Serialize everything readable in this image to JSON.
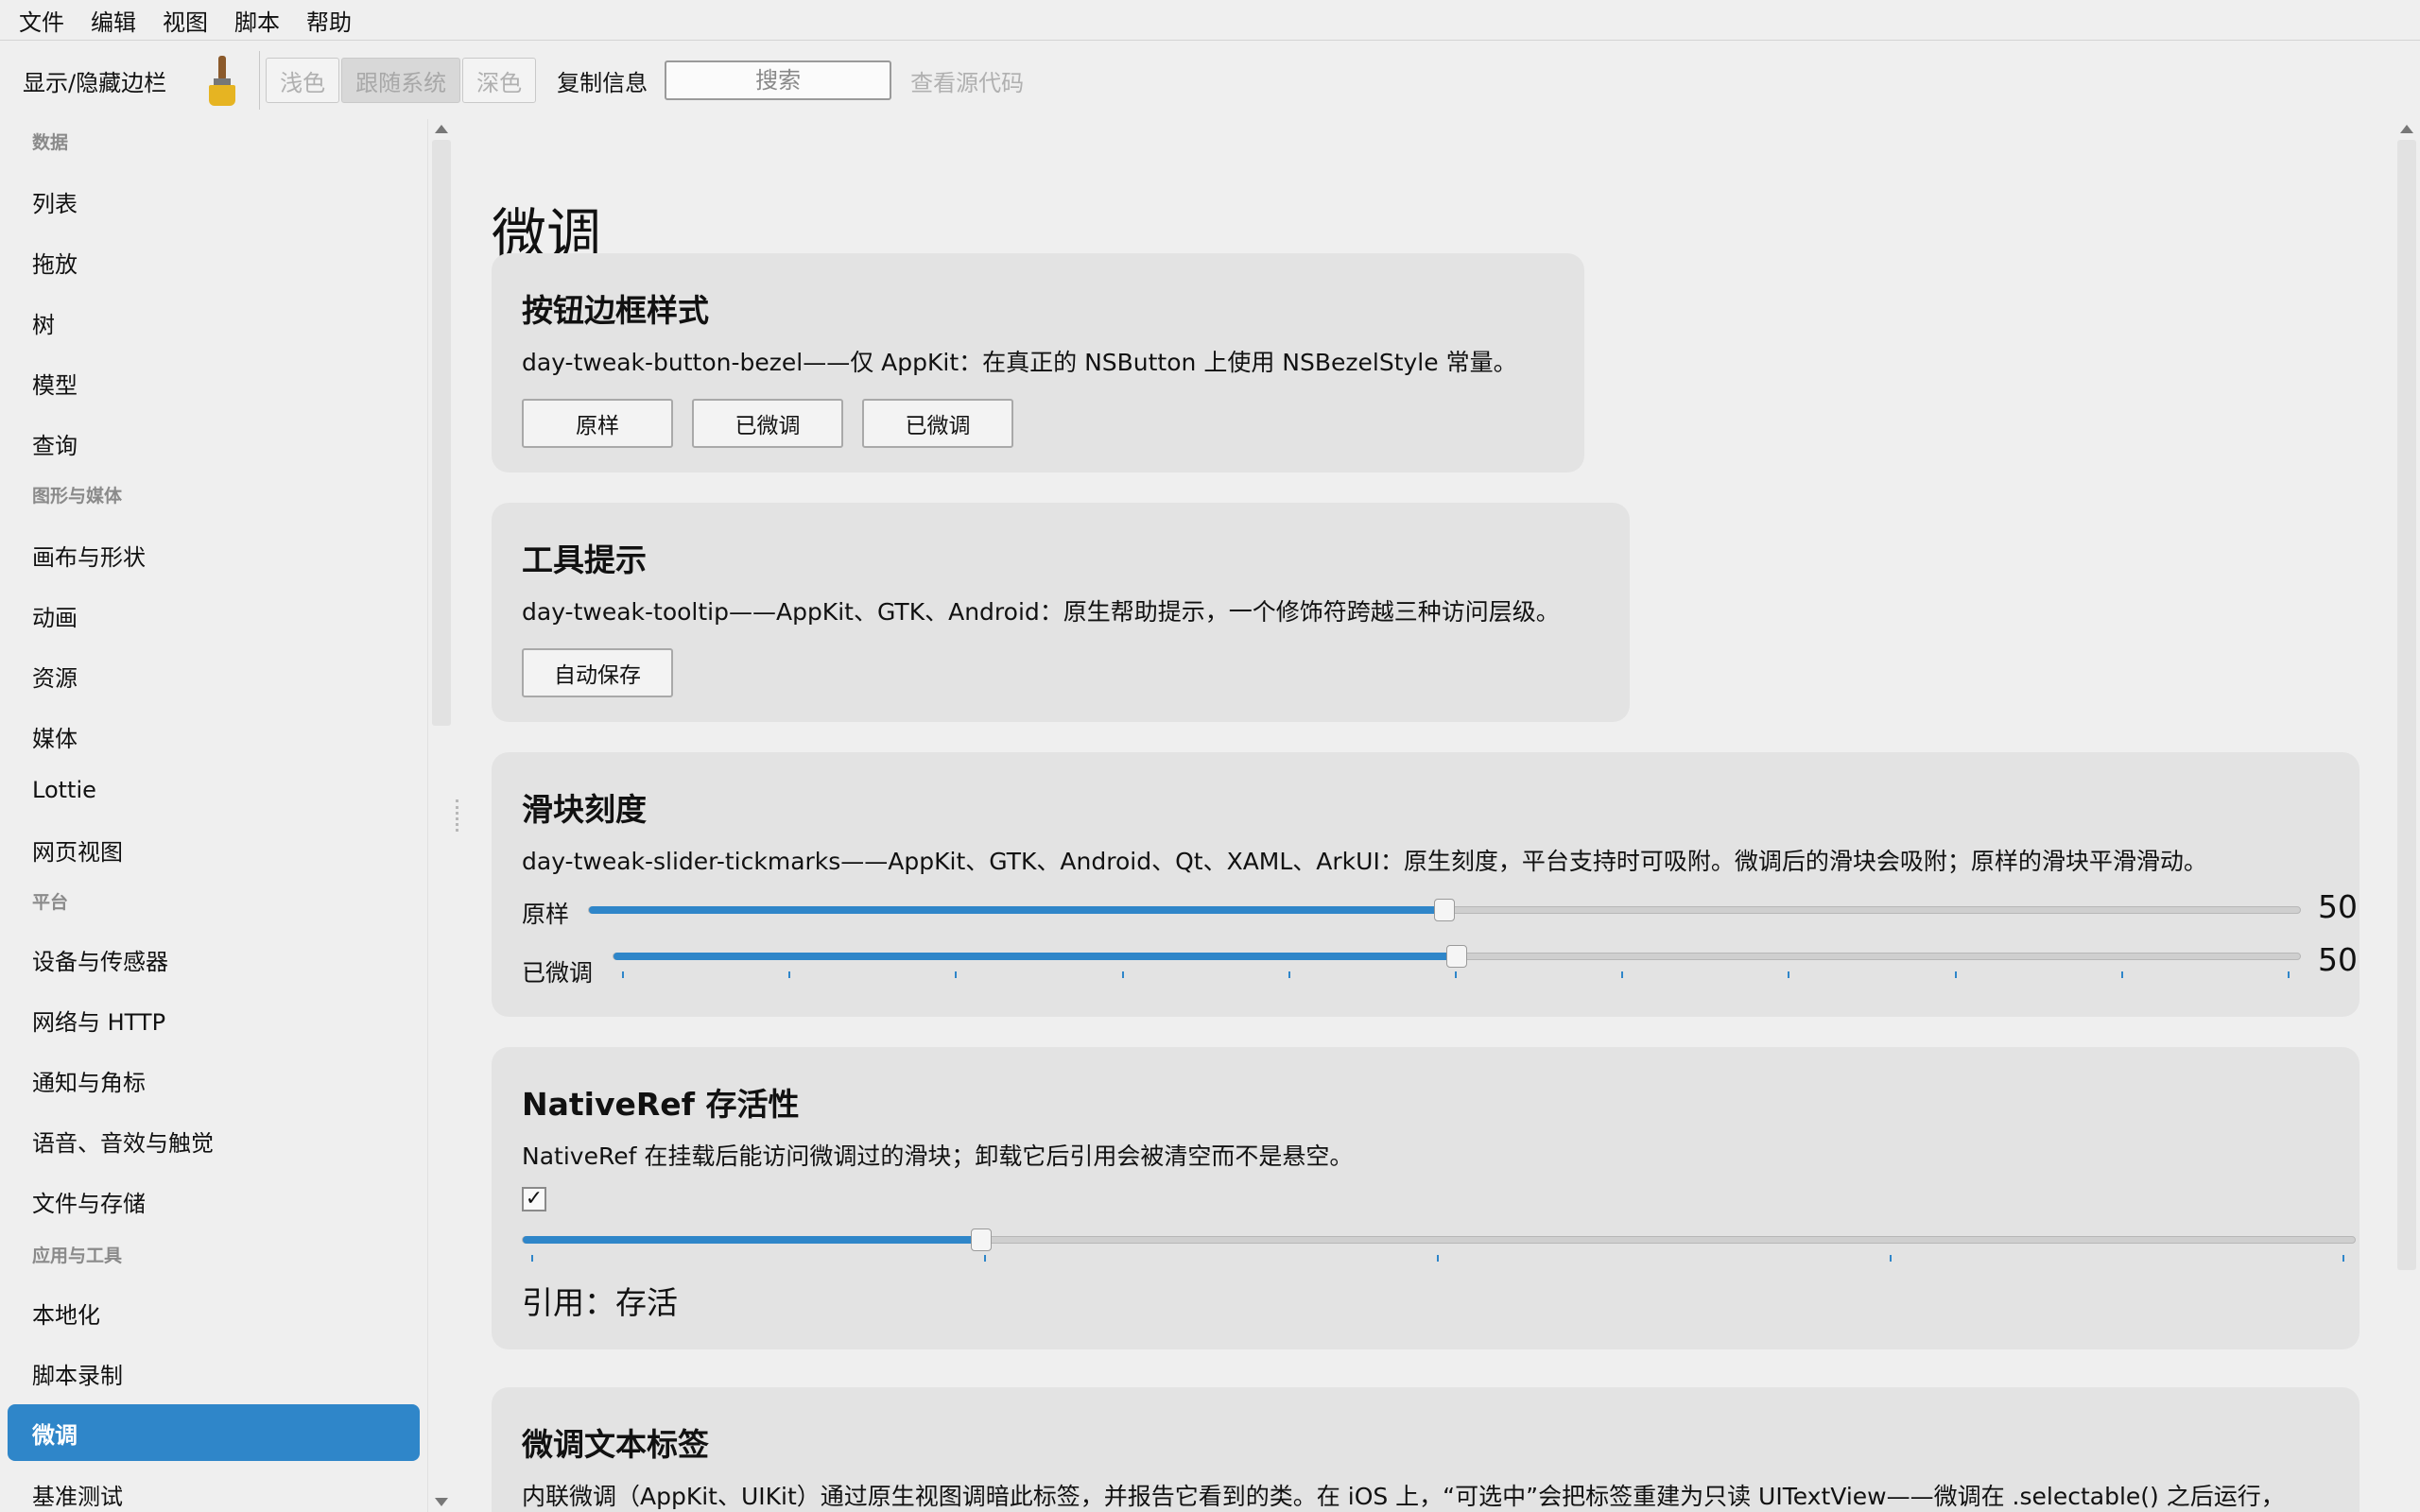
{
  "menubar": {
    "items": [
      "文件",
      "编辑",
      "视图",
      "脚本",
      "帮助"
    ]
  },
  "toolbar": {
    "toggle_sidebar": "显示/隐藏边栏",
    "brush_icon": "paintbrush-icon",
    "theme": {
      "light": "浅色",
      "system": "跟随系统",
      "dark": "深色",
      "selected": "跟随系统"
    },
    "copy_info": "复制信息",
    "search_placeholder": "搜索",
    "view_source": "查看源代码"
  },
  "sidebar": {
    "sections": [
      {
        "title": "数据",
        "items": [
          "列表",
          "拖放",
          "树",
          "模型",
          "查询"
        ]
      },
      {
        "title": "图形与媒体",
        "items": [
          "画布与形状",
          "动画",
          "资源",
          "媒体",
          "Lottie",
          "网页视图"
        ]
      },
      {
        "title": "平台",
        "items": [
          "设备与传感器",
          "网络与 HTTP",
          "通知与角标",
          "语音、音效与触觉",
          "文件与存储"
        ]
      },
      {
        "title": "应用与工具",
        "items": [
          "本地化",
          "脚本录制",
          "微调",
          "基准测试"
        ]
      }
    ],
    "selected": "微调",
    "accent": "#2f86c9"
  },
  "main": {
    "title": "微调",
    "cards": {
      "bezel": {
        "title": "按钮边框样式",
        "desc": "day-tweak-button-bezel——仅 AppKit：在真正的 NSButton 上使用 NSBezelStyle 常量。",
        "buttons": [
          "原样",
          "已微调",
          "已微调"
        ]
      },
      "tooltip": {
        "title": "工具提示",
        "desc": "day-tweak-tooltip——AppKit、GTK、Android：原生帮助提示，一个修饰符跨越三种访问层级。",
        "button": "自动保存"
      },
      "slider": {
        "title": "滑块刻度",
        "desc": "day-tweak-slider-tickmarks——AppKit、GTK、Android、Qt、XAML、ArkUI：原生刻度，平台支持时可吸附。微调后的滑块会吸附；原样的滑块平滑滑动。",
        "rows": [
          {
            "label": "原样",
            "value": 50,
            "value_text": "50",
            "min": 0,
            "max": 100
          },
          {
            "label": "已微调",
            "value": 50,
            "value_text": "50",
            "min": 0,
            "max": 100,
            "ticks": 11
          }
        ]
      },
      "nativeref": {
        "title": "NativeRef 存活性",
        "desc": "NativeRef 在挂载后能访问微调过的滑块；卸载它后引用会被清空而不是悬空。",
        "checked": true,
        "check_mark": "✓",
        "slider_fraction": 0.25,
        "ticks": 5,
        "ref_text": "引用：存活"
      },
      "label": {
        "title": "微调文本标签",
        "desc": "内联微调（AppKit、UIKit）通过原生视图调暗此标签，并报告它看到的类。在 iOS 上，“可选中”会把标签重建为只读 UITextView——微调在 .selectable() 之后运行，"
      }
    }
  }
}
